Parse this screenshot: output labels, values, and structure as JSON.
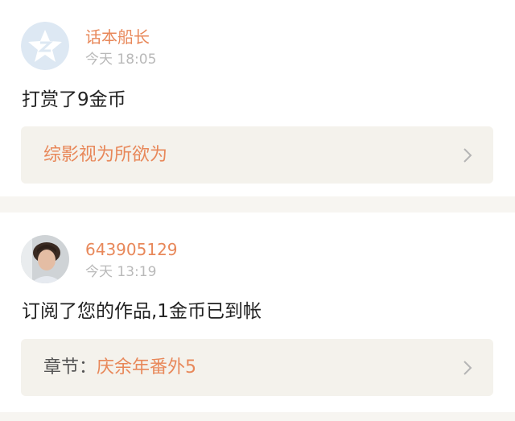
{
  "notifications": [
    {
      "avatar_icon": "qzone-star-avatar-icon",
      "username": "话本船长",
      "time": "今天 18:05",
      "message": "打赏了9金币",
      "link_prefix": "",
      "link_text": "综影视为所欲为"
    },
    {
      "avatar_icon": "user-photo-avatar",
      "username": "643905129",
      "time": "今天 13:19",
      "message": "订阅了您的作品,1金币已到帐",
      "link_prefix": "章节：",
      "link_text": "庆余年番外5"
    }
  ],
  "colors": {
    "accent": "#e8885a",
    "time": "#b9b9b9",
    "link_bg": "#f4f2ec",
    "separator": "#f7f5f1"
  }
}
